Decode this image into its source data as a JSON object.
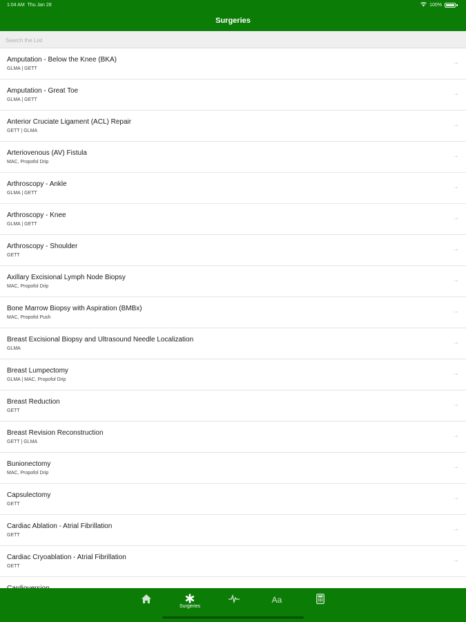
{
  "status": {
    "time": "1:04 AM",
    "date": "Thu Jan 28",
    "battery": "100%"
  },
  "header": {
    "title": "Surgeries"
  },
  "search": {
    "placeholder": "Search the List"
  },
  "rows": [
    {
      "title": "Amputation - Below the Knee (BKA)",
      "subtitle": "GLMA | GETT"
    },
    {
      "title": "Amputation - Great Toe",
      "subtitle": "GLMA | GETT"
    },
    {
      "title": "Anterior Cruciate Ligament (ACL) Repair",
      "subtitle": "GETT | GLMA"
    },
    {
      "title": "Arteriovenous (AV) Fistula",
      "subtitle": "MAC, Propofol Drip"
    },
    {
      "title": "Arthroscopy - Ankle",
      "subtitle": "GLMA | GETT"
    },
    {
      "title": "Arthroscopy - Knee",
      "subtitle": "GLMA | GETT"
    },
    {
      "title": "Arthroscopy - Shoulder",
      "subtitle": "GETT"
    },
    {
      "title": "Axillary Excisional Lymph Node Biopsy",
      "subtitle": "MAC, Propofol Drip"
    },
    {
      "title": "Bone Marrow Biopsy with Aspiration (BMBx)",
      "subtitle": "MAC, Propofol Push"
    },
    {
      "title": "Breast Excisional Biopsy and Ultrasound Needle Localization",
      "subtitle": "GLMA"
    },
    {
      "title": "Breast Lumpectomy",
      "subtitle": "GLMA | MAC, Propofol Drip"
    },
    {
      "title": "Breast Reduction",
      "subtitle": "GETT"
    },
    {
      "title": "Breast Revision Reconstruction",
      "subtitle": "GETT | GLMA"
    },
    {
      "title": "Bunionectomy",
      "subtitle": "MAC, Propofol Drip"
    },
    {
      "title": "Capsulectomy",
      "subtitle": "GETT"
    },
    {
      "title": "Cardiac Ablation - Atrial Fibrillation",
      "subtitle": "GETT"
    },
    {
      "title": "Cardiac Cryoablation - Atrial Fibrillation",
      "subtitle": "GETT"
    },
    {
      "title": "Cardioversion",
      "subtitle": ""
    }
  ],
  "chevron": "→",
  "tabs": {
    "surgeries_label": "Surgeries",
    "aa_label": "Aa"
  },
  "colors": {
    "brand": "#0b7d07",
    "separator": "#e4e4e4"
  }
}
